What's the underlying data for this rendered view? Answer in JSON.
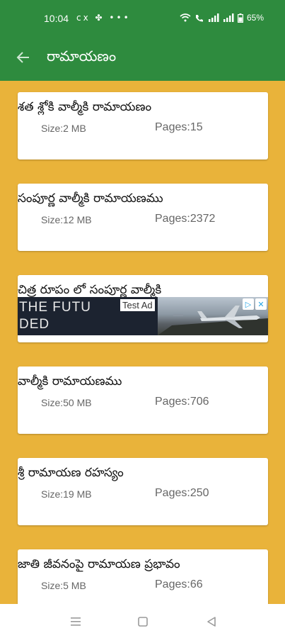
{
  "status_bar": {
    "time": "10:04",
    "left_icons": [
      "data-icon",
      "fan-icon",
      "more-icon"
    ],
    "battery": "65%"
  },
  "app_bar": {
    "title": "రామాయణం",
    "back_icon": "arrow-back-icon"
  },
  "books": [
    {
      "title": "శత శ్లోకి వాల్మీకి రామాయణం",
      "size": "Size:2 MB",
      "pages": "Pages:15"
    },
    {
      "title": "సంపూర్ణ వాల్మీకి రామాయణము",
      "size": "Size:12 MB",
      "pages": "Pages:2372"
    },
    {
      "title": "చిత్ర రూపం లో సంపూర్ణ వాల్మీకి",
      "size": "",
      "pages": ""
    },
    {
      "title": "వాల్మీకి రామాయణము",
      "size": "Size:50 MB",
      "pages": "Pages:706"
    },
    {
      "title": "శ్రీ రామాయణ రహస్యం",
      "size": "Size:19 MB",
      "pages": "Pages:250"
    },
    {
      "title": "జాతి జీవనంపై రామాయణ ప్రభావం",
      "size": "Size:5 MB",
      "pages": "Pages:66"
    }
  ],
  "ad": {
    "line1": "THE FUTU",
    "line2": "DED",
    "badge": "Test Ad"
  },
  "colors": {
    "primary": "#2e8b3e",
    "background": "#e9b33a",
    "card": "#ffffff"
  },
  "nav_bar": {
    "icons": [
      "recents-icon",
      "home-icon",
      "back-triangle-icon"
    ]
  }
}
